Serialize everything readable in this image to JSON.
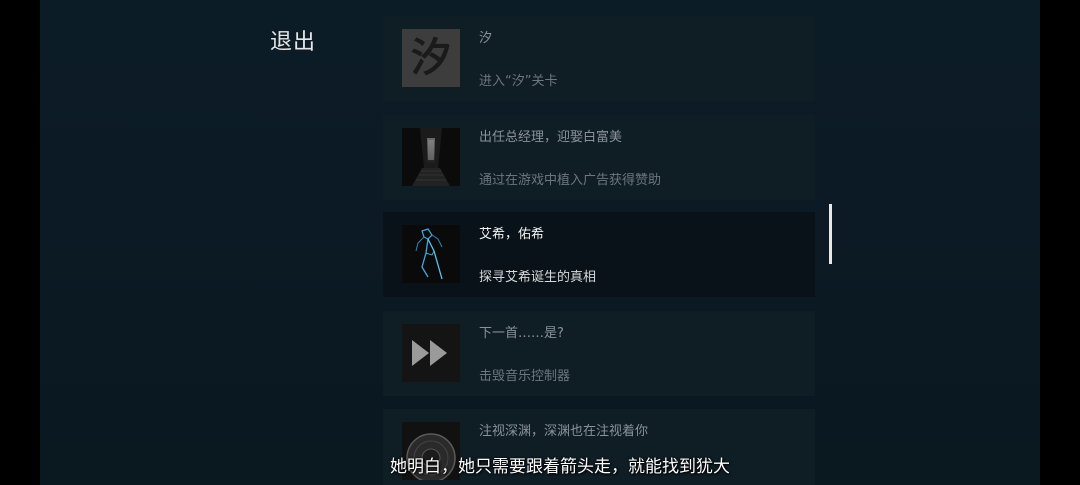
{
  "exit_label": "退出",
  "achievements": [
    {
      "title": "汐",
      "desc": "进入“汐”关卡",
      "thumb_char": "汐",
      "icon": "xi-calligraphy-icon"
    },
    {
      "title": "出任总经理，迎娶白富美",
      "desc": "通过在游戏中植入广告获得赞助",
      "icon": "corridor-door-icon"
    },
    {
      "title": "艾希，佑希",
      "desc": "探寻艾希诞生的真相",
      "icon": "aisi-figure-icon"
    },
    {
      "title": "下一首……是?",
      "desc": "击毁音乐控制器",
      "icon": "fast-forward-icon"
    },
    {
      "title": "注视深渊，深渊也在注视着你",
      "desc": "",
      "icon": "disc-icon"
    }
  ],
  "subtitle": "她明白，她只需要跟着箭头走，就能找到犹大",
  "colors": {
    "background": "#0b1a24",
    "item_bg": "#0f1d25",
    "selected_bg": "#091218",
    "accent_line": "#e8e8e8"
  }
}
